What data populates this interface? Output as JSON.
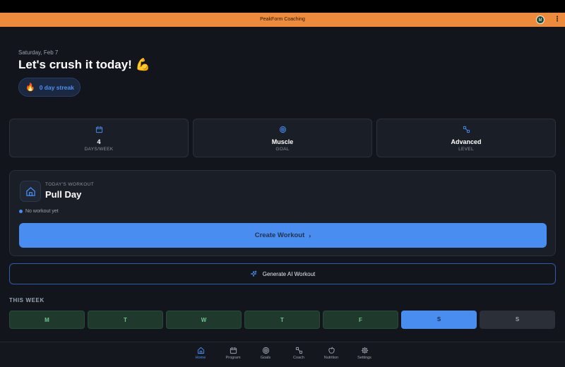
{
  "header": {
    "title": "PeakForm Coaching",
    "avatar_initial": "M",
    "more_glyph": "⋮"
  },
  "hero": {
    "date": "Saturday, Feb 7",
    "greeting": "Let's crush it today! 💪",
    "streak_icon": "🔥",
    "streak_text": "0 day streak"
  },
  "stats": [
    {
      "icon": "calendar-icon",
      "value": "4",
      "label": "DAYS/WEEK"
    },
    {
      "icon": "target-icon",
      "value": "Muscle",
      "label": "GOAL"
    },
    {
      "icon": "dumbbell-icon",
      "value": "Advanced",
      "label": "LEVEL"
    }
  ],
  "workout": {
    "section_label": "TODAY'S WORKOUT",
    "title": "Pull Day",
    "status": "No workout yet",
    "create_label": "Create Workout",
    "chevron": "›"
  },
  "ai_button": {
    "label": "Generate AI Workout"
  },
  "week": {
    "label": "THIS WEEK",
    "days": [
      {
        "letter": "M",
        "state": "done"
      },
      {
        "letter": "T",
        "state": "done"
      },
      {
        "letter": "W",
        "state": "done"
      },
      {
        "letter": "T",
        "state": "done"
      },
      {
        "letter": "F",
        "state": "done"
      },
      {
        "letter": "S",
        "state": "today"
      },
      {
        "letter": "S",
        "state": "future"
      }
    ]
  },
  "nav": [
    {
      "label": "Home",
      "icon": "home-icon",
      "active": true
    },
    {
      "label": "Program",
      "icon": "calendar-icon",
      "active": false
    },
    {
      "label": "Goals",
      "icon": "target-icon",
      "active": false
    },
    {
      "label": "Coach",
      "icon": "dumbbell-icon",
      "active": false
    },
    {
      "label": "Nutrition",
      "icon": "apple-icon",
      "active": false
    },
    {
      "label": "Settings",
      "icon": "gear-icon",
      "active": false
    }
  ],
  "colors": {
    "accent": "#4a8df0",
    "header": "#ee8a3c",
    "done": "#1f3a2c",
    "background": "#12151c"
  }
}
